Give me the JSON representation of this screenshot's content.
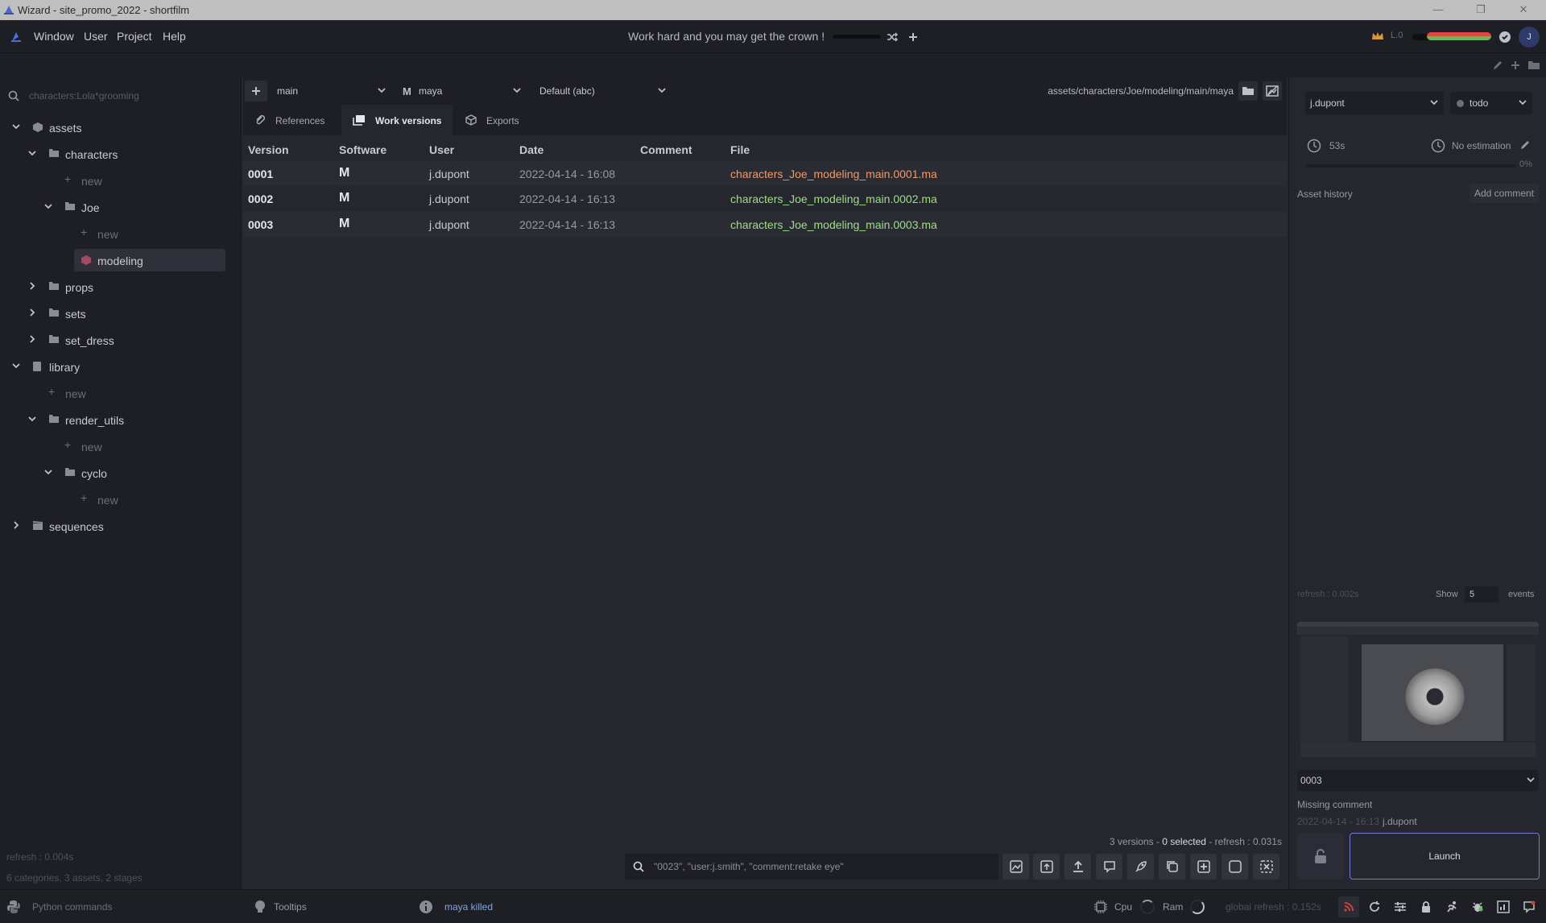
{
  "window": {
    "title": "Wizard - site_promo_2022 - shortfilm"
  },
  "menu": [
    "Window",
    "User",
    "Project",
    "Help"
  ],
  "motd": "Work hard and you may get the crown !",
  "user": {
    "level": "0",
    "avatar_letter": "J"
  },
  "tree": {
    "search_placeholder": "characters:Lola*grooming",
    "rows": [
      {
        "label": "assets"
      },
      {
        "label": "characters"
      },
      {
        "label": "new"
      },
      {
        "label": "Joe"
      },
      {
        "label": "new"
      },
      {
        "label": "modeling"
      },
      {
        "label": "props"
      },
      {
        "label": "sets"
      },
      {
        "label": "set_dress"
      },
      {
        "label": "library"
      },
      {
        "label": "new"
      },
      {
        "label": "render_utils"
      },
      {
        "label": "new"
      },
      {
        "label": "cyclo"
      },
      {
        "label": "new"
      },
      {
        "label": "sequences"
      }
    ],
    "footer_refresh": "refresh : 0.004s",
    "footer_stats": "6 categories, 3 assets, 2 stages"
  },
  "center": {
    "variant": "main",
    "software": "maya",
    "export_format": "Default (abc)",
    "path": "assets/characters/Joe/modeling/main/maya",
    "tabs": [
      "References",
      "Work versions",
      "Exports"
    ],
    "columns": [
      "Version",
      "Software",
      "User",
      "Date",
      "Comment",
      "File"
    ],
    "rows": [
      {
        "version": "0001",
        "software": "M",
        "user": "j.dupont",
        "date": "2022-04-14 - 16:08",
        "comment": "",
        "file": "characters_Joe_modeling_main.0001.ma",
        "file_color": "#f09968"
      },
      {
        "version": "0002",
        "software": "M",
        "user": "j.dupont",
        "date": "2022-04-14 - 16:13",
        "comment": "",
        "file": "characters_Joe_modeling_main.0002.ma",
        "file_color": "#9ddf85"
      },
      {
        "version": "0003",
        "software": "M",
        "user": "j.dupont",
        "date": "2022-04-14 - 16:13",
        "comment": "",
        "file": "characters_Joe_modeling_main.0003.ma",
        "file_color": "#9ddf85"
      }
    ],
    "status": {
      "versions": "3 versions - ",
      "selected": "0 selected",
      "refresh": " - refresh : 0.031s"
    },
    "filter_placeholder": "\"0023\", \"user:j.smith\", \"comment:retake eye\""
  },
  "right": {
    "assignee": "j.dupont",
    "state": "todo",
    "time_spent": "53s",
    "estimation": "No estimation",
    "progress": "0%",
    "history_label": "Asset history",
    "add_comment": "Add comment",
    "refresh": "refresh : 0.002s",
    "show_label": "Show",
    "show_count": "5",
    "events_label": "events",
    "version_select": "0003",
    "version_comment": "Missing comment",
    "version_date": "2022-04-14 - 16:13",
    "version_user": "j.dupont",
    "launch": "Launch"
  },
  "bottom": {
    "python": "Python commands",
    "tooltips": "Tooltips",
    "info": "maya killed",
    "cpu": "Cpu",
    "ram": "Ram",
    "global_refresh": "global refresh : 0.152s"
  },
  "colors": {
    "accent": "#6e7dd6",
    "ok": "#9ddf85",
    "warn": "#f09968"
  }
}
